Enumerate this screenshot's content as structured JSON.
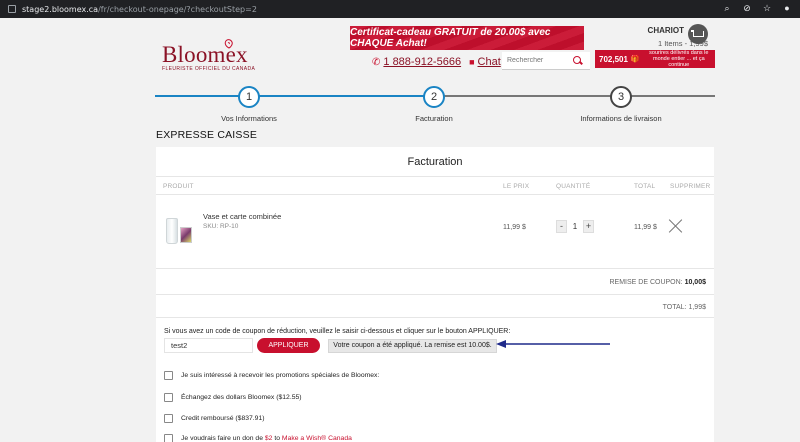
{
  "browser": {
    "url_host": "stage2.bloomex.ca",
    "url_path": "/fr/checkout-onepage/?checkoutStep=2"
  },
  "header": {
    "logo_text": "Bloomex",
    "logo_tagline": "FLEURISTE OFFICIEL DU CANADA",
    "gift_banner": "Certificat-cadeau GRATUIT de 20.00$ avec CHAQUE Achat!",
    "phone": "1 888-912-5666",
    "chat": "Chat",
    "search_placeholder": "Rechercher",
    "cart_title": "CHARIOT",
    "cart_items": "1 Items - 1,99$",
    "promo_number": "702,501",
    "promo_text": "sourires délivrés dans le monde entier ... et ça continue"
  },
  "steps": [
    {
      "number": "1",
      "label": "Vos Informations"
    },
    {
      "number": "2",
      "label": "Facturation"
    },
    {
      "number": "3",
      "label": "Informations de livraison"
    }
  ],
  "page_title": "EXPRESSE CAISSE",
  "panel": {
    "title": "Facturation",
    "columns": {
      "product": "PRODUIT",
      "price": "LE PRIX",
      "quantity": "QUANTITÉ",
      "total": "TOTAL",
      "remove": "SUPPRIMER"
    },
    "item": {
      "name": "Vase et carte combinée",
      "sku": "SKU: RP-10",
      "price": "11,99 $",
      "quantity": "1",
      "total": "11,99 $",
      "minus": "-",
      "plus": "+"
    },
    "coupon_discount_label": "REMISE DE COUPON:",
    "coupon_discount_value": "10,00$",
    "total_label": "TOTAL:",
    "total_value": "1,99$"
  },
  "coupon": {
    "instructions": "Si vous avez un code de coupon de réduction, veuillez le saisir ci-dessous et cliquer sur le bouton APPLIQUER:",
    "value": "test2",
    "apply_label": "APPLIQUER",
    "message": "Votre coupon a été appliqué. La remise est 10.00$."
  },
  "options": [
    {
      "label": "Je suis intéressé à recevoir les promotions spéciales de Bloomex:"
    },
    {
      "label": "Échangez des dollars Bloomex ($12.55)"
    },
    {
      "label": "Credit remboursé ($837.91)"
    }
  ],
  "donation": {
    "prefix": "Je voudrais faire un don de",
    "amount": "$2",
    "to": "to",
    "charity": "Make a Wish® Canada"
  },
  "colors": {
    "brand_red": "#c8102e",
    "step_blue": "#1a84c4",
    "arrow_navy": "#1f2a8a"
  }
}
